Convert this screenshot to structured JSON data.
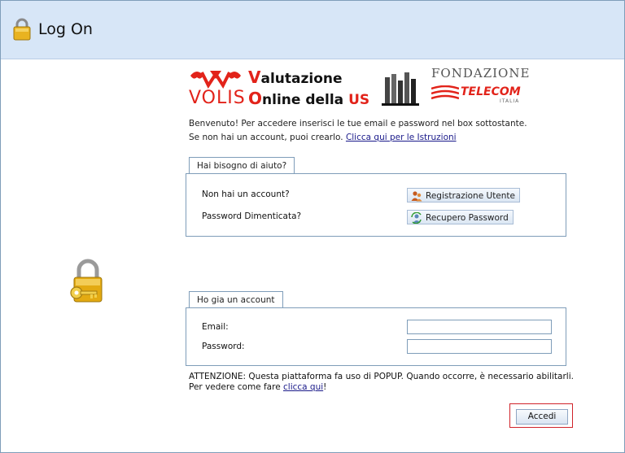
{
  "header": {
    "title": "Log On"
  },
  "logos": {
    "volis_text": "VOLIS",
    "title_line1_initial": "V",
    "title_line1_rest": "alutazione",
    "title_line2_initial": "O",
    "title_line2_rest": "nline della ",
    "title_line2_us": "US",
    "fondazione": "FONDAZIONE",
    "telecom": "TELECOM",
    "italia": "ITALIA"
  },
  "intro": {
    "line1": "Benvenuto! Per accedere inserisci le tue email e password nel box sottostante.",
    "line2_prefix": "Se non hai un account, puoi crearlo. ",
    "line2_link": "Clicca qui per le Istruzioni"
  },
  "help_panel": {
    "tab": "Hai bisogno di aiuto?",
    "no_account_label": "Non hai un account?",
    "register_button": "Registrazione Utente",
    "forgot_label": "Password Dimenticata?",
    "recover_button": "Recupero Password"
  },
  "login_panel": {
    "tab": "Ho gia un account",
    "email_label": "Email:",
    "email_value": "",
    "password_label": "Password:",
    "password_value": ""
  },
  "note": {
    "line1": "ATTENZIONE: Questa piattaforma fa uso di POPUP. Quando occorre, è necessario abilitarli.",
    "line2_prefix": "Per vedere come fare ",
    "line2_link": "clicca qui",
    "line2_suffix": "!"
  },
  "submit": {
    "label": "Accedi"
  },
  "icons": {
    "header": "padlock-icon",
    "side": "key-lock-icon",
    "register": "users-icon",
    "recover": "refresh-user-icon"
  },
  "colors": {
    "header_bg": "#d7e6f7",
    "border": "#7f9db9",
    "brand_red": "#e2231a",
    "highlight": "#d0232a"
  }
}
